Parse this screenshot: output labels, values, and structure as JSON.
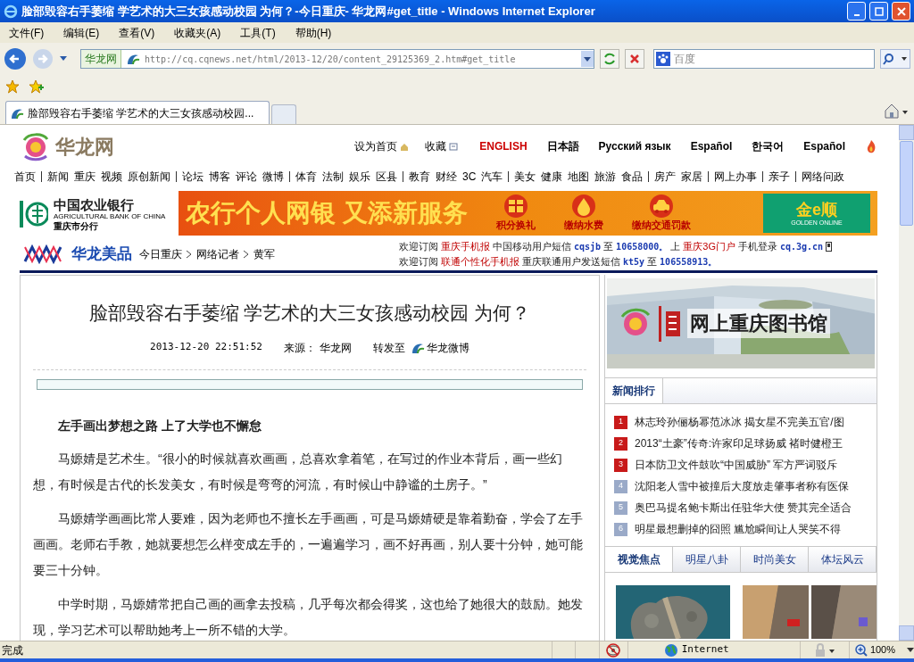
{
  "window": {
    "title": "脸部毁容右手萎缩 学艺术的大三女孩感动校园 为何？-今日重庆- 华龙网#get_title - Windows Internet Explorer"
  },
  "menu": [
    "文件(F)",
    "编辑(E)",
    "查看(V)",
    "收藏夹(A)",
    "工具(T)",
    "帮助(H)"
  ],
  "address_bar": {
    "site_label": "华龙网",
    "url": "http://cq.cqnews.net/html/2013-12/20/content_29125369_2.htm#get_title"
  },
  "search": {
    "placeholder": "百度"
  },
  "tabs": [
    {
      "label": "脸部毁容右手萎缩 学艺术的大三女孩感动校园...",
      "selected": true
    }
  ],
  "site_header": {
    "logo": "华龙网",
    "links": [
      {
        "label": "设为首页",
        "kind": "home"
      },
      {
        "label": "收藏",
        "kind": "bookmark"
      }
    ],
    "languages": [
      {
        "label": "ENGLISH",
        "color": "#cc0000"
      },
      {
        "label": "日本語",
        "color": "#000000"
      },
      {
        "label": "Русский язык",
        "color": "#000000"
      },
      {
        "label": "Español",
        "color": "#000000"
      },
      {
        "label": "한국어",
        "color": "#000000"
      },
      {
        "label": "Español",
        "color": "#000000"
      }
    ]
  },
  "nav": [
    [
      "首页"
    ],
    [
      "新闻",
      "重庆",
      "视频",
      "原创新闻"
    ],
    [
      "论坛",
      "博客",
      "评论",
      "微博"
    ],
    [
      "体育",
      "法制",
      "娱乐",
      "区县"
    ],
    [
      "教育",
      "财经",
      "3C",
      "汽车"
    ],
    [
      "美女",
      "健康",
      "地图",
      "旅游",
      "食品"
    ],
    [
      "房产",
      "家居"
    ],
    [
      "网上办事"
    ],
    [
      "亲子"
    ],
    [
      "网络问政"
    ]
  ],
  "ad_banner": {
    "bank_name": "中国农业银行",
    "bank_name_en": "AGRICULTURAL BANK OF CHINA",
    "branch": "重庆市分行",
    "slogan": "农行个人网银 又添新服务",
    "services": [
      "积分换礼",
      "缴纳水费",
      "缴纳交通罚款"
    ],
    "brand": "金e顺",
    "brand_en": "GOLDEN ONLINE"
  },
  "channel": {
    "logo": "华龙美品",
    "breadcrumb": [
      "今日重庆",
      "网络记者",
      "黄军"
    ]
  },
  "subscriptions": [
    [
      {
        "text": "欢迎订阅",
        "kind": "plain"
      },
      {
        "text": "重庆手机报",
        "kind": "link"
      },
      {
        "text": "中国移动用户短信",
        "kind": "plain"
      },
      {
        "text": "cqsjb",
        "kind": "code"
      },
      {
        "text": "至",
        "kind": "plain"
      },
      {
        "text": "10658000。",
        "kind": "code"
      },
      {
        "text": "上",
        "kind": "plain"
      },
      {
        "text": "重庆3G门户",
        "kind": "link"
      },
      {
        "text": "手机登录",
        "kind": "plain"
      },
      {
        "text": "cq.3g.cn",
        "kind": "code"
      }
    ],
    [
      {
        "text": "欢迎订阅",
        "kind": "plain"
      },
      {
        "text": "联通个性化手机报",
        "kind": "link"
      },
      {
        "text": "重庆联通用户发送短信",
        "kind": "plain"
      },
      {
        "text": "kt5y",
        "kind": "code"
      },
      {
        "text": "至",
        "kind": "plain"
      },
      {
        "text": "106558913。",
        "kind": "code"
      }
    ]
  ],
  "article": {
    "title": "脸部毁容右手萎缩 学艺术的大三女孩感动校园 为何？",
    "date": "2013-12-20 22:51:52",
    "source_label": "来源：",
    "source": "华龙网",
    "share_label": "转发至",
    "share_target": "华龙微博",
    "subheading": "左手画出梦想之路 上了大学也不懈怠",
    "paragraphs": [
      "马嫄婧是艺术生。“很小的时候就喜欢画画，总喜欢拿着笔，在写过的作业本背后，画一些幻想，有时候是古代的长发美女，有时候是弯弯的河流，有时候山中静谧的土房子。”",
      "马嫄婧学画画比常人要难，因为老师也不擅长左手画画，可是马嫄婧硬是靠着勤奋，学会了左手画画。老师右手教，她就要想怎么样变成左手的，一遍遍学习，画不好再画，别人要十分钟，她可能要三十分钟。",
      "中学时期，马嫄婧常把自己画的画拿去投稿，几乎每次都会得奖，这也给了她很大的鼓励。她发现，学习艺术可以帮助她考上一所不错的大学。"
    ]
  },
  "sidebar": {
    "banner_text": "网上重庆图书馆",
    "ranking_title": "新闻排行",
    "ranking": [
      {
        "rank": "1",
        "title": "林志玲孙俪杨幂范冰冰 揭女星不完美五官/图",
        "top": true
      },
      {
        "rank": "2",
        "title": "2013“土豪”传奇:许家印足球扬威 褚时健橙王",
        "top": true
      },
      {
        "rank": "3",
        "title": "日本防卫文件鼓吹“中国威胁” 军方严词驳斥",
        "top": true
      },
      {
        "rank": "4",
        "title": "沈阳老人雪中被撞后大度放走肇事者称有医保",
        "top": false
      },
      {
        "rank": "5",
        "title": "奥巴马提名鲍卡斯出任驻华大使 赞其完全适合",
        "top": false
      },
      {
        "rank": "6",
        "title": "明星最想删掉的囧照 尴尬瞬间让人哭笑不得",
        "top": false
      }
    ],
    "photo_tabs": [
      {
        "label": "视觉焦点",
        "selected": true
      },
      {
        "label": "明星八卦",
        "selected": false
      },
      {
        "label": "时尚美女",
        "selected": false
      },
      {
        "label": "体坛风云",
        "selected": false
      }
    ]
  },
  "status_bar": {
    "text": "完成",
    "zone": "Internet",
    "zoom": "100%"
  }
}
